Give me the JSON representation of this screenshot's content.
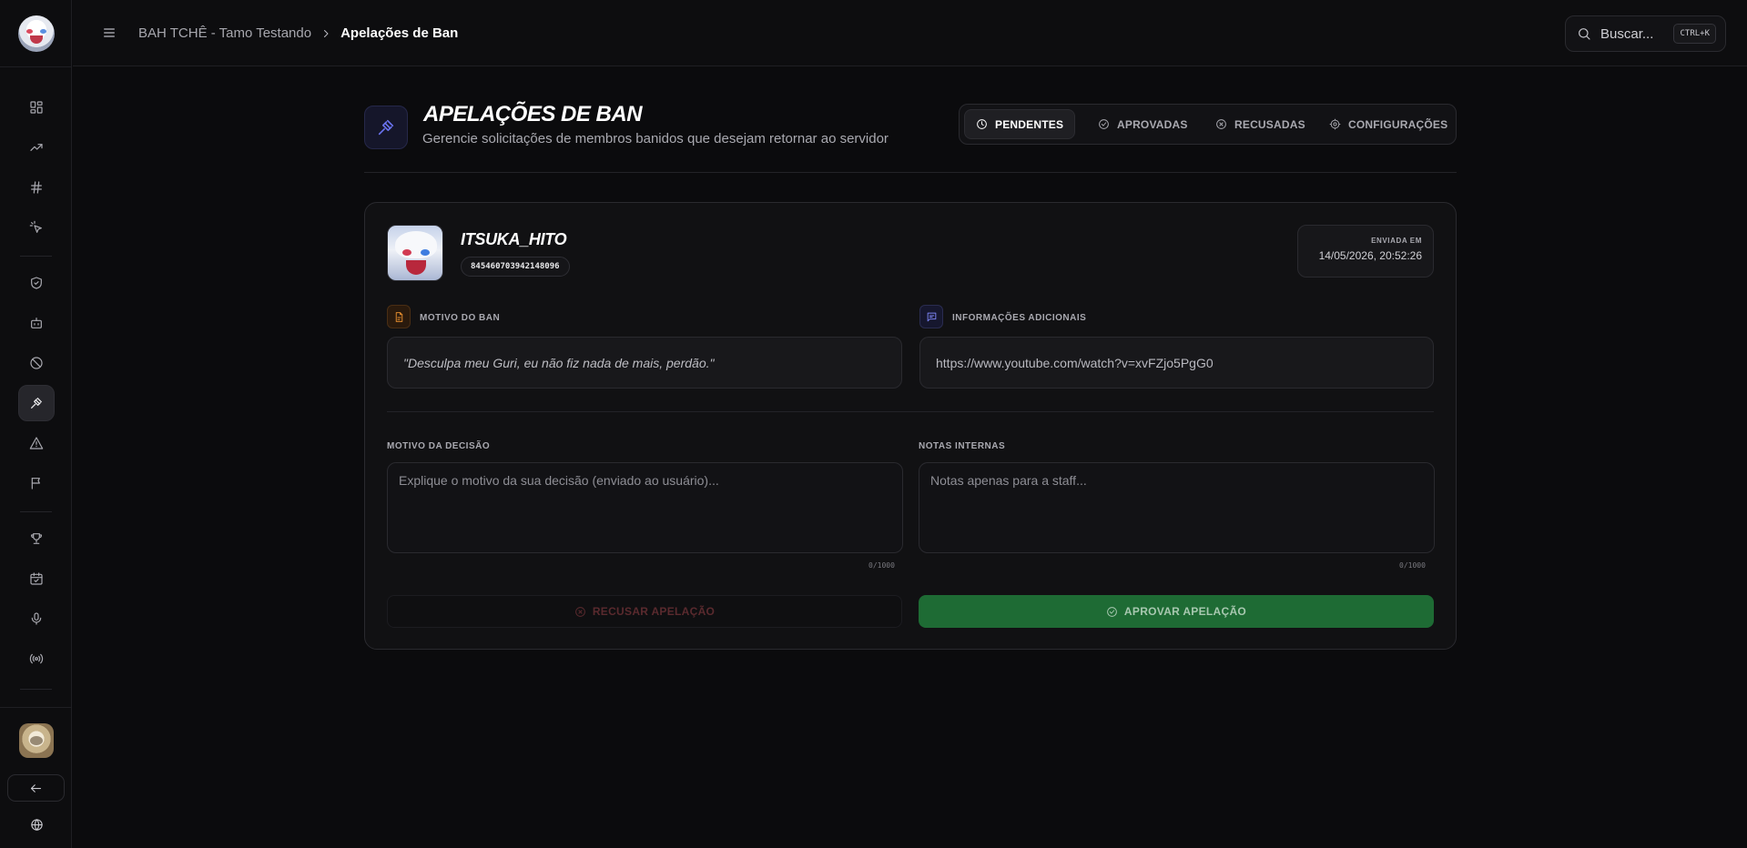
{
  "breadcrumb": {
    "server": "BAH TCHÊ - Tamo Testando",
    "current": "Apelações de Ban"
  },
  "search": {
    "placeholder": "Buscar...",
    "shortcut": "CTRL+K"
  },
  "header": {
    "title": "APELAÇÕES DE BAN",
    "subtitle": "Gerencie solicitações de membros banidos que desejam retornar ao servidor"
  },
  "tabs": [
    {
      "label": "PENDENTES",
      "icon": "clock-icon",
      "active": true
    },
    {
      "label": "APROVADAS",
      "icon": "check-circle-icon",
      "active": false
    },
    {
      "label": "RECUSADAS",
      "icon": "x-circle-icon",
      "active": false
    },
    {
      "label": "CONFIGURAÇÕES",
      "icon": "gear-icon",
      "active": false
    }
  ],
  "appeal": {
    "username": "ITSUKA_HITO",
    "user_id": "845460703942148096",
    "sent_label": "ENVIADA EM",
    "sent_date": "14/05/2026, 20:52:26",
    "ban_reason_label": "MOTIVO DO BAN",
    "ban_reason": "\"Desculpa meu Guri, eu não fiz nada de mais, perdão.\"",
    "extra_info_label": "INFORMAÇÕES ADICIONAIS",
    "extra_info": "https://www.youtube.com/watch?v=xvFZjo5PgG0"
  },
  "form": {
    "decision_label": "MOTIVO DA DECISÃO",
    "decision_placeholder": "Explique o motivo da sua decisão (enviado ao usuário)...",
    "decision_counter": "0/1000",
    "notes_label": "NOTAS INTERNAS",
    "notes_placeholder": "Notas apenas para a staff...",
    "notes_counter": "0/1000",
    "reject_label": "RECUSAR APELAÇÃO",
    "approve_label": "APROVAR APELAÇÃO"
  },
  "colors": {
    "accent": "#6a73f0",
    "approve": "#1e6b34",
    "ban_reason": "#e08a2e"
  },
  "sidebar": {
    "icons": [
      "dashboard-icon",
      "trending-icon",
      "hash-icon",
      "sparkle-cursor-icon",
      "shield-check-icon",
      "bot-icon",
      "ban-icon",
      "gavel-icon",
      "alert-triangle-icon",
      "flag-icon",
      "trophy-icon",
      "calendar-check-icon",
      "microphone-icon",
      "broadcast-icon"
    ],
    "active": "gavel-icon"
  }
}
